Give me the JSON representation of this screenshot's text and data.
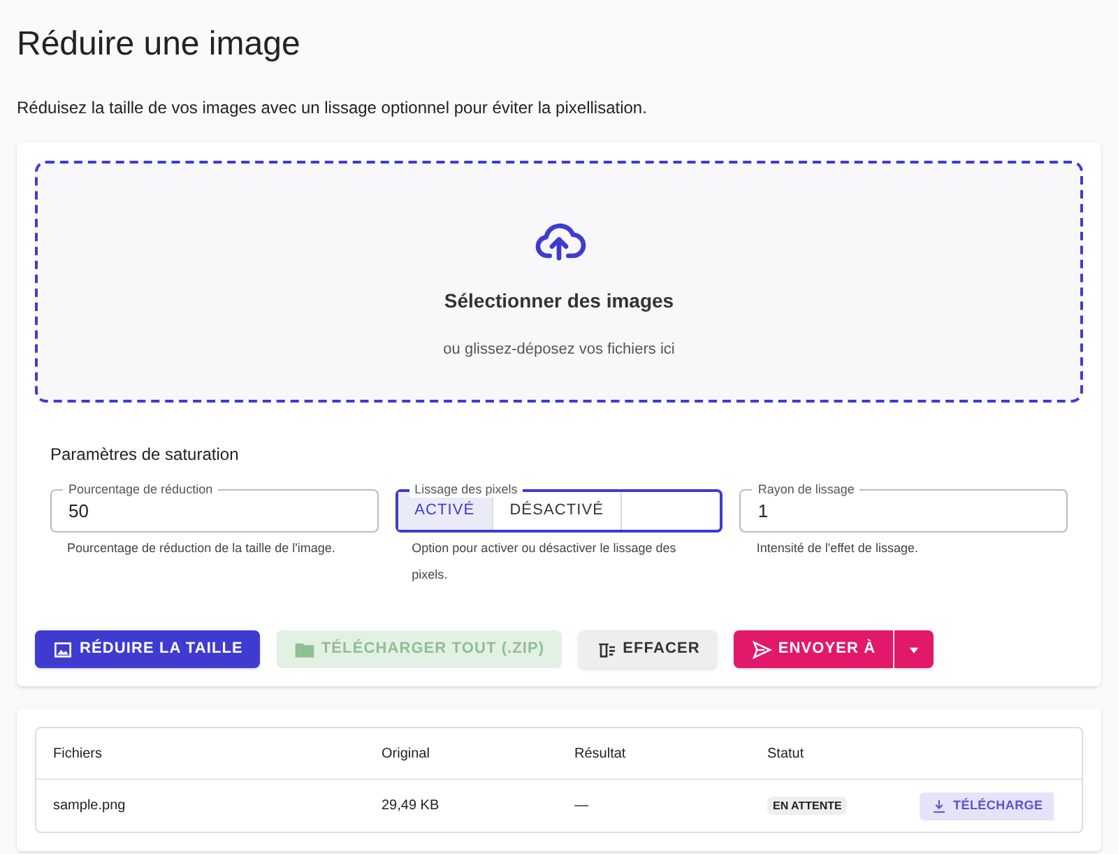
{
  "title": "Réduire une image",
  "subtitle": "Réduisez la taille de vos images avec un lissage optionnel pour éviter la pixellisation.",
  "dropzone": {
    "title": "Sélectionner des images",
    "hint": "ou glissez-déposez vos fichiers ici"
  },
  "settings": {
    "title": "Paramètres de saturation",
    "fields": [
      {
        "kind": "text",
        "label": "Pourcentage de réduction",
        "value": "50",
        "help": "Pourcentage de réduction de la taille de l'image."
      },
      {
        "kind": "toggle",
        "label": "Lissage des pixels",
        "options": [
          {
            "label": "ACTIVÉ",
            "selected": true
          },
          {
            "label": "DÉSACTIVÉ",
            "selected": false
          }
        ],
        "help": "Option pour activer ou désactiver le lissage des pixels."
      },
      {
        "kind": "text",
        "label": "Rayon de lissage",
        "value": "1",
        "help": "Intensité de l'effet de lissage."
      }
    ]
  },
  "buttons": [
    {
      "kind": "primary",
      "label": "RÉDUIRE LA TAILLE",
      "disabled": false
    },
    {
      "kind": "success",
      "label": "TÉLÉCHARGER TOUT (.ZIP)",
      "disabled": true
    },
    {
      "kind": "neutral",
      "label": "EFFACER",
      "disabled": false
    },
    {
      "kind": "send",
      "label": "ENVOYER À",
      "disabled": false
    }
  ],
  "table": {
    "columns": [
      "Fichiers",
      "Original",
      "Résultat",
      "Statut"
    ],
    "rows": [
      {
        "file": "sample.png",
        "original": "29,49 KB",
        "result": "—",
        "status": "EN ATTENTE",
        "action": {
          "label": "TÉLÉCHARGE",
          "disabled": true
        }
      }
    ]
  }
}
